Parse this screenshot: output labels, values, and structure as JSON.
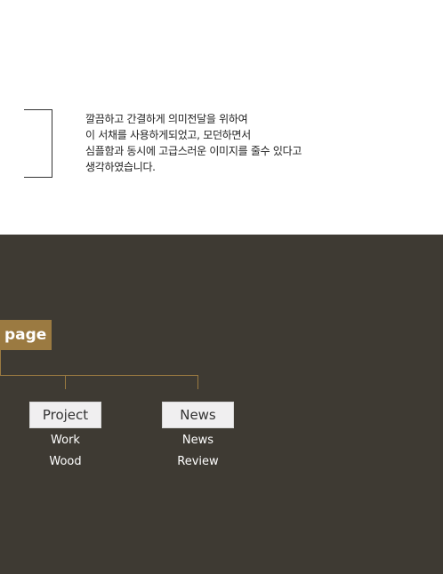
{
  "intro": {
    "lines": [
      "깔끔하고 간결하게 의미전달을 위하여",
      "이 서채를 사용하게되었고, 모던하면서",
      "심플함과 동시에 고급스러운 이미지를 줄수 있다고",
      "생각하였습니다."
    ]
  },
  "sitemap": {
    "label": "page",
    "nodes": [
      {
        "label": "Project",
        "items": [
          "Work",
          "Wood"
        ]
      },
      {
        "label": "News",
        "items": [
          "News",
          "Review"
        ]
      }
    ]
  },
  "colors": {
    "accent": "#9b7a41",
    "dark_bg": "#3e3a33"
  }
}
